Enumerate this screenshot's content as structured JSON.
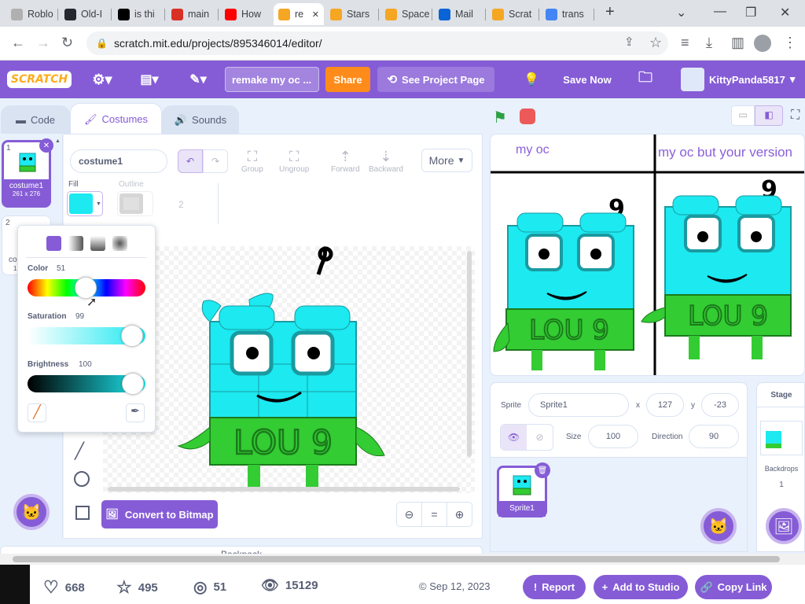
{
  "browser": {
    "tabs": [
      {
        "label": "Roblo",
        "color": "#b0b0b0"
      },
      {
        "label": "Old-I",
        "color": "#24292f"
      },
      {
        "label": "is thi",
        "color": "#000000"
      },
      {
        "label": "main",
        "color": "#d93025"
      },
      {
        "label": "How",
        "color": "#ff0000"
      },
      {
        "label": "re",
        "color": "#f5a623"
      },
      {
        "label": "Stars",
        "color": "#f5a623"
      },
      {
        "label": "Space",
        "color": "#f5a623"
      },
      {
        "label": "Mail",
        "color": "#0a64d6"
      },
      {
        "label": "Scrat",
        "color": "#f5a623"
      },
      {
        "label": "trans",
        "color": "#4285f4"
      }
    ],
    "url": "scratch.mit.edu/projects/895346014/editor/"
  },
  "menu": {
    "logo": "SCRATCH",
    "project_title": "remake my oc ...",
    "share": "Share",
    "see_project_page": "See Project Page",
    "save_now": "Save Now",
    "username": "KittyPanda5817"
  },
  "editor_tabs": {
    "code": "Code",
    "costumes": "Costumes",
    "sounds": "Sounds"
  },
  "costumes": [
    {
      "num": "1",
      "name": "costume1",
      "size": "261 x 276"
    },
    {
      "num": "2",
      "name": "co",
      "size": "1("
    }
  ],
  "paint": {
    "costume_name": "costume1",
    "group": "Group",
    "ungroup": "Ungroup",
    "forward": "Forward",
    "backward": "Backward",
    "more": "More",
    "fill_label": "Fill",
    "outline_label": "Outline",
    "outline_width": "2",
    "convert": "Convert to Bitmap",
    "fill_color": "#1ce9f0"
  },
  "color_picker": {
    "color_label": "Color",
    "color_value": "51",
    "saturation_label": "Saturation",
    "saturation_value": "99",
    "brightness_label": "Brightness",
    "brightness_value": "100",
    "color_level": 0.51,
    "saturation_level": 0.99,
    "brightness_level": 1.0
  },
  "stage_text": {
    "left": "my oc",
    "right": "my oc but your version",
    "lou": "LOU 9",
    "digit": "9"
  },
  "sprite_info": {
    "sprite_label": "Sprite",
    "sprite_name": "Sprite1",
    "x_label": "x",
    "x": "127",
    "y_label": "y",
    "y": "-23",
    "show_label": "Show",
    "size_label": "Size",
    "size": "100",
    "direction_label": "Direction",
    "direction": "90"
  },
  "sprites": [
    {
      "name": "Sprite1"
    }
  ],
  "stage_panel": {
    "title": "Stage",
    "backdrops_label": "Backdrops",
    "backdrops_count": "1"
  },
  "backpack": "Backpack",
  "stats": {
    "loves": "668",
    "favorites": "495",
    "remixes": "51",
    "views": "15129",
    "date": "© Sep 12, 2023"
  },
  "actions": {
    "report": "Report",
    "add_to_studio": "Add to Studio",
    "copy_link": "Copy Link"
  }
}
